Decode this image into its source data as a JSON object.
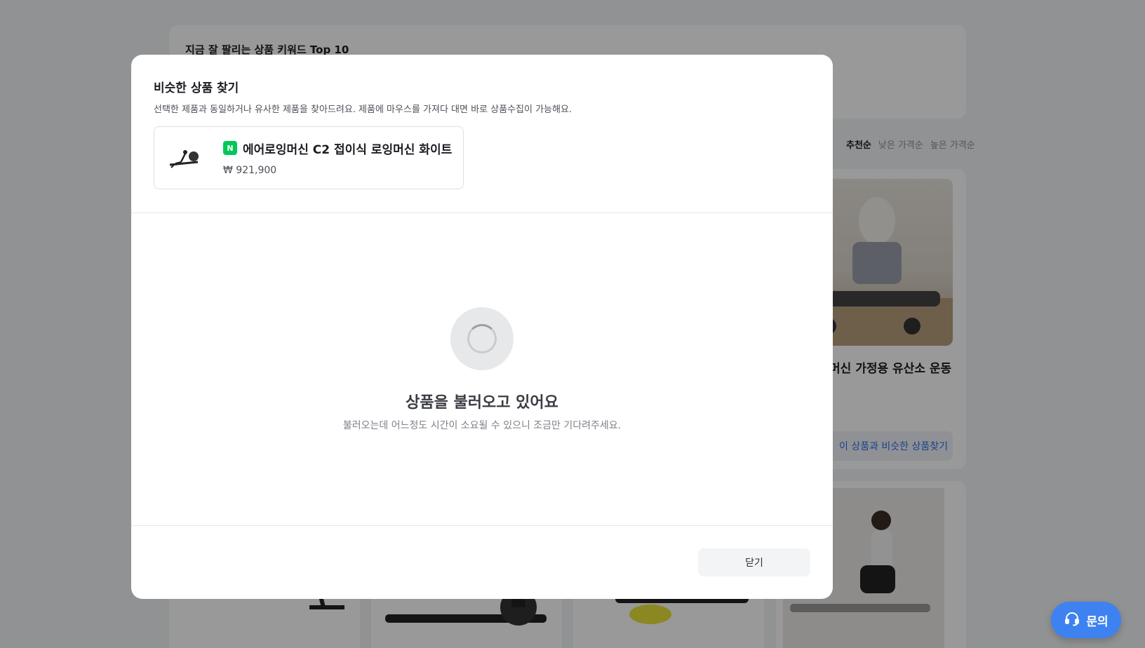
{
  "background": {
    "keyword_title": "지금 잘 팔리는 상품 키워드 Top 10",
    "sort_options": [
      "추천순",
      "낮은 가격순",
      "높은 가격순"
    ],
    "product_name_partial": "머신 가정용 유산소 운동",
    "similar_button_partial": "이 상품과 비슷한 상품찾기"
  },
  "modal": {
    "title": "비슷한 상품 찾기",
    "description": "선택한 제품과 동일하거나 유사한 제품을 찾아드려요. 제품에 마우스를 가져다 대면 바로 상품수집이 가능해요.",
    "ref_product": {
      "badge": "N",
      "name": "에어로잉머신 C2 접이식 로잉머신 화이트",
      "price": "₩ 921,900"
    },
    "loading_title": "상품을 불러오고 있어요",
    "loading_desc": "불러오는데 어느정도 시간이 소요될 수 있으니 조금만 기다려주세요.",
    "close_label": "닫기"
  },
  "help": {
    "label": "문의",
    "icon": "headset-icon"
  },
  "colors": {
    "accent": "#3d82f0",
    "naver_green": "#03c75a",
    "link_blue": "#2f6fe4"
  }
}
